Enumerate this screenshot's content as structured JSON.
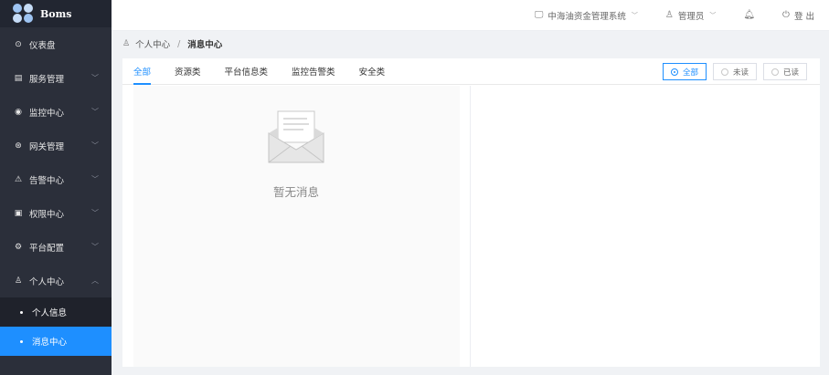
{
  "brand": {
    "name": "Boms"
  },
  "sidebar": {
    "items": [
      {
        "icon": "dashboard-icon",
        "glyph": "⊙",
        "label": "仪表盘",
        "has_arrow": false
      },
      {
        "icon": "server-icon",
        "glyph": "▤",
        "label": "服务管理",
        "has_arrow": true
      },
      {
        "icon": "monitor-icon",
        "glyph": "◉",
        "label": "监控中心",
        "has_arrow": true
      },
      {
        "icon": "gateway-icon",
        "glyph": "⊛",
        "label": "网关管理",
        "has_arrow": true
      },
      {
        "icon": "alert-icon",
        "glyph": "⚠",
        "label": "告警中心",
        "has_arrow": true
      },
      {
        "icon": "lock-icon",
        "glyph": "▣",
        "label": "权限中心",
        "has_arrow": true
      },
      {
        "icon": "settings-icon",
        "glyph": "⚙",
        "label": "平台配置",
        "has_arrow": true
      },
      {
        "icon": "user-icon",
        "glyph": "♙",
        "label": "个人中心",
        "has_arrow": true,
        "expanded": true
      }
    ],
    "sub_items": [
      {
        "label": "个人信息",
        "active": false
      },
      {
        "label": "消息中心",
        "active": true
      }
    ]
  },
  "topbar": {
    "system_label": "中海油资金管理系统",
    "user_label": "管理员",
    "logout_label": "登 出"
  },
  "breadcrumb": {
    "parent": "个人中心",
    "separator": "/",
    "current": "消息中心"
  },
  "tabs": [
    {
      "label": "全部",
      "active": true
    },
    {
      "label": "资源类",
      "active": false
    },
    {
      "label": "平台信息类",
      "active": false
    },
    {
      "label": "监控告警类",
      "active": false
    },
    {
      "label": "安全类",
      "active": false
    }
  ],
  "filters": [
    {
      "label": "全部",
      "active": true
    },
    {
      "label": "未读",
      "active": false
    },
    {
      "label": "已读",
      "active": false
    }
  ],
  "empty_state": {
    "text": "暂无消息"
  },
  "colors": {
    "accent": "#1e8fff",
    "sidebar_bg": "#2b2f3a",
    "sidebar_active": "#1e8fff"
  }
}
